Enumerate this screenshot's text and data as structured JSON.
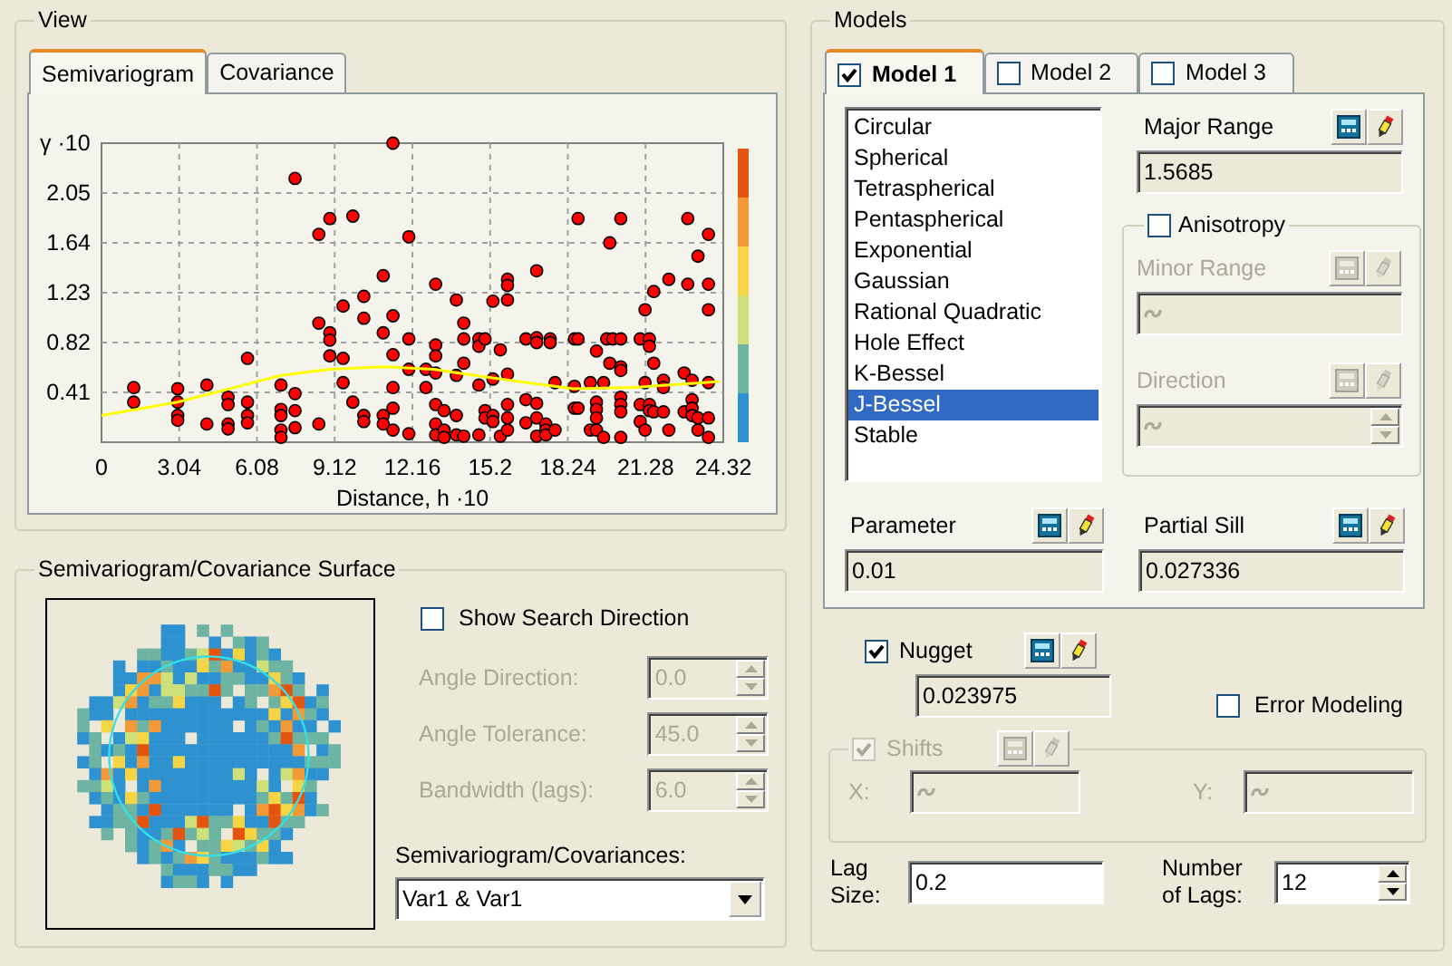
{
  "view": {
    "title": "View",
    "tabs": [
      {
        "label": "Semivariogram",
        "selected": true
      },
      {
        "label": "Covariance",
        "selected": false
      }
    ],
    "chart_data": {
      "type": "scatter",
      "grid": true,
      "xlabel": "Distance, h ·10",
      "ylabel": "γ ·10",
      "xlim": [
        0,
        24.32
      ],
      "ylim": [
        0,
        2.46
      ],
      "xticks": [
        {
          "value": 0,
          "label": "0"
        },
        {
          "value": 3.04,
          "label": "3.04"
        },
        {
          "value": 6.08,
          "label": "6.08"
        },
        {
          "value": 9.12,
          "label": "9.12"
        },
        {
          "value": 12.16,
          "label": "12.16"
        },
        {
          "value": 15.2,
          "label": "15.2"
        },
        {
          "value": 18.24,
          "label": "18.24"
        },
        {
          "value": 21.28,
          "label": "21.28"
        },
        {
          "value": 24.32,
          "label": "24.32"
        }
      ],
      "yticks": [
        {
          "value": 0.41,
          "label": "0.41"
        },
        {
          "value": 0.82,
          "label": "0.82"
        },
        {
          "value": 1.23,
          "label": "1.23"
        },
        {
          "value": 1.64,
          "label": "1.64"
        },
        {
          "value": 2.05,
          "label": "2.05"
        }
      ],
      "series": [
        {
          "color": "#ff0000",
          "x": [
            1.26,
            1.26,
            2.98,
            2.98,
            2.98,
            2.98,
            4.12,
            4.12,
            4.95,
            4.95,
            4.95,
            4.95,
            5.71,
            5.71,
            5.71,
            5.71,
            7.02,
            7.02,
            7.02,
            7.02,
            7.02,
            7.57,
            7.57,
            7.57,
            7.57,
            8.5,
            8.5,
            8.5,
            8.93,
            8.93,
            8.93,
            8.93,
            9.45,
            9.45,
            9.45,
            9.83,
            9.83,
            10.26,
            10.26,
            10.26,
            10.26,
            11.02,
            11.02,
            11.02,
            11.02,
            11.4,
            11.4,
            11.4,
            11.4,
            11.4,
            11.4,
            12.02,
            12.02,
            12.02,
            12.02,
            12.69,
            12.69,
            13.07,
            13.07,
            13.07,
            13.07,
            13.07,
            13.07,
            13.07,
            13.4,
            13.4,
            13.4,
            13.88,
            13.88,
            13.88,
            13.88,
            14.17,
            14.17,
            14.17,
            14.17,
            14.76,
            14.76,
            14.76,
            14.76,
            15,
            15,
            15,
            15.31,
            15.31,
            15.31,
            15.31,
            15.6,
            15.6,
            15.88,
            15.88,
            15.88,
            15.88,
            15.88,
            15.88,
            15.88,
            16.6,
            16.6,
            16.6,
            17.02,
            17.02,
            17.02,
            17.02,
            17.02,
            17.02,
            17.38,
            17.38,
            17.38,
            17.55,
            17.55,
            17.74,
            17.74,
            18.5,
            18.5,
            18.5,
            18.64,
            18.64,
            18.64,
            19.12,
            19.12,
            19.36,
            19.36,
            19.36,
            19.36,
            19.36,
            19.64,
            19.64,
            19.76,
            19.88,
            19.88,
            20,
            20.31,
            20.31,
            20.31,
            20.31,
            20.31,
            20.31,
            20.31,
            20.31,
            21.07,
            21.07,
            21.07,
            21.26,
            21.26,
            21.26,
            21.43,
            21.43,
            21.43,
            21.43,
            21.6,
            21.6,
            21.6,
            21.98,
            21.98,
            21.98,
            22.19,
            22.19,
            22.79,
            22.79,
            22.93,
            22.93,
            23.1,
            23.1,
            23.1,
            23.1,
            23.33,
            23.33,
            23.33,
            23.74,
            23.74,
            23.74,
            23.74,
            23.74,
            23.74
          ],
          "values": [
            0.45,
            0.33,
            0.44,
            0.33,
            0.22,
            0.18,
            0.47,
            0.15,
            0.37,
            0.31,
            0.15,
            0.11,
            0.69,
            0.33,
            0.22,
            0.16,
            0.47,
            0.27,
            0.22,
            0.1,
            0.04,
            2.17,
            0.4,
            0.26,
            0.12,
            0.98,
            0.15,
            1.71,
            1.84,
            0.9,
            0.84,
            0.71,
            1.12,
            0.69,
            0.49,
            1.86,
            0.33,
            1.2,
            1.02,
            0.22,
            0.17,
            1.37,
            0.9,
            0.22,
            0.15,
            2.46,
            1.04,
            0.72,
            0.45,
            0.28,
            0.1,
            1.69,
            0.85,
            0.6,
            0.07,
            0.6,
            0.45,
            1.3,
            0.8,
            0.71,
            0.57,
            0.31,
            0.15,
            0.06,
            0.26,
            0.1,
            0.04,
            1.17,
            0.55,
            0.22,
            0.06,
            0.98,
            0.85,
            0.65,
            0.05,
            0.85,
            0.79,
            0.47,
            0.06,
            0.85,
            0.26,
            0.2,
            1.16,
            0.52,
            0.22,
            0.17,
            0.76,
            0.05,
            1.34,
            1.29,
            1.17,
            0.56,
            0.31,
            0.2,
            0.1,
            0.85,
            0.35,
            0.16,
            1.41,
            0.86,
            0.82,
            0.32,
            0.2,
            0.05,
            0.15,
            0.1,
            0.06,
            0.85,
            0.82,
            0.49,
            0.1,
            0.85,
            0.46,
            0.28,
            1.84,
            0.85,
            0.28,
            0.49,
            0.1,
            0.75,
            0.33,
            0.27,
            0.2,
            0.1,
            0.49,
            0.04,
            0.85,
            1.64,
            0.65,
            0.85,
            1.84,
            0.85,
            0.62,
            0.59,
            0.37,
            0.31,
            0.25,
            0.04,
            0.85,
            0.31,
            0.17,
            1.09,
            0.49,
            0.1,
            0.85,
            0.79,
            0.31,
            0.26,
            1.24,
            0.65,
            0.25,
            0.51,
            0.45,
            0.25,
            1.34,
            0.1,
            0.57,
            0.25,
            1.84,
            1.3,
            0.51,
            0.35,
            0.28,
            0.22,
            1.53,
            0.2,
            0.1,
            1.71,
            1.3,
            1.09,
            0.49,
            0.2,
            0.04
          ]
        },
        {
          "type": "line",
          "color": "#ffff00",
          "x": [
            0,
            2.98,
            7.02,
            8.93,
            11.07,
            12.98,
            15.6,
            18.45,
            20.83,
            24.17
          ],
          "values": [
            0.22,
            0.33,
            0.55,
            0.6,
            0.62,
            0.6,
            0.52,
            0.44,
            0.45,
            0.5
          ]
        }
      ]
    }
  },
  "surface": {
    "title": "Semivariogram/Covariance Surface",
    "show_search_direction": {
      "label": "Show Search Direction",
      "checked": false
    },
    "search_fields": [
      {
        "label": "Angle Direction:",
        "value": "0.0",
        "disabled": true
      },
      {
        "label": "Angle Tolerance:",
        "value": "45.0",
        "disabled": true
      },
      {
        "label": "Bandwidth (lags):",
        "value": "6.0",
        "disabled": true
      }
    ],
    "covariances": {
      "label": "Semivariogram/Covariances:",
      "value": "Var1 & Var1"
    }
  },
  "models": {
    "title": "Models",
    "tabs": [
      {
        "label": "Model 1",
        "checked": true,
        "selected": true
      },
      {
        "label": "Model 2",
        "checked": false,
        "selected": false
      },
      {
        "label": "Model 3",
        "checked": false,
        "selected": false
      }
    ],
    "model_types": [
      {
        "label": "Circular",
        "selected": false
      },
      {
        "label": "Spherical",
        "selected": false
      },
      {
        "label": "Tetraspherical",
        "selected": false
      },
      {
        "label": "Pentaspherical",
        "selected": false
      },
      {
        "label": "Exponential",
        "selected": false
      },
      {
        "label": "Gaussian",
        "selected": false
      },
      {
        "label": "Rational Quadratic",
        "selected": false
      },
      {
        "label": "Hole Effect",
        "selected": false
      },
      {
        "label": "K-Bessel",
        "selected": false
      },
      {
        "label": "J-Bessel",
        "selected": true
      },
      {
        "label": "Stable",
        "selected": false
      }
    ],
    "major_range": {
      "label": "Major Range",
      "value": "1.5685"
    },
    "anisotropy": {
      "label": "Anisotropy",
      "checked": false,
      "fields": [
        {
          "label": "Minor Range",
          "kind": "text",
          "disabled": true
        },
        {
          "label": "Direction",
          "kind": "spin",
          "disabled": true
        }
      ]
    },
    "parameter": {
      "label": "Parameter",
      "value": "0.01"
    },
    "partial_sill": {
      "label": "Partial Sill",
      "value": "0.027336"
    },
    "nugget": {
      "label": "Nugget",
      "checked": true,
      "value": "0.023975"
    },
    "error_modeling": {
      "label": "Error Modeling",
      "checked": false
    },
    "shifts": {
      "label": "Shifts",
      "checked": true,
      "disabled": true,
      "fields": [
        {
          "label": "X:"
        },
        {
          "label": "Y:"
        }
      ]
    },
    "lag_size": {
      "label": "Lag Size:",
      "value": "0.2"
    },
    "number_of_lags": {
      "label": "Number of Lags:",
      "value": "12"
    }
  }
}
